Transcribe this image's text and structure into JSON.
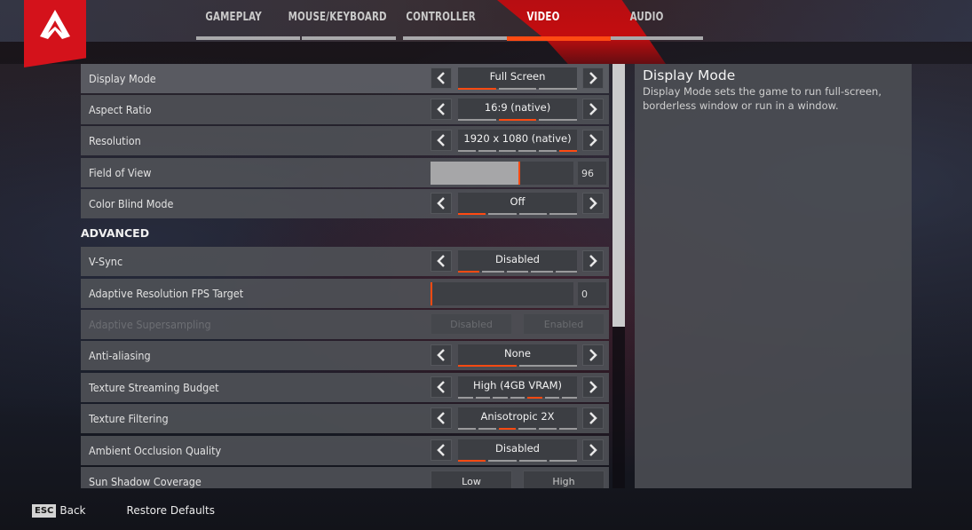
{
  "nav": {
    "logo": "apex-legends-logo",
    "tabs": [
      {
        "label": "GAMEPLAY",
        "active": false
      },
      {
        "label": "MOUSE/KEYBOARD",
        "active": false
      },
      {
        "label": "CONTROLLER",
        "active": false
      },
      {
        "label": "VIDEO",
        "active": true
      },
      {
        "label": "AUDIO",
        "active": false
      }
    ]
  },
  "colors": {
    "accent": "#ff4a12",
    "brand_red": "#d4121b",
    "row_bg": "#4e5056",
    "control_bg": "#3c3e43"
  },
  "settings": {
    "basic": [
      {
        "label": "Display Mode",
        "type": "selector",
        "value": "Full Screen",
        "options_count": 3,
        "selected_index": 0,
        "selected": true
      },
      {
        "label": "Aspect Ratio",
        "type": "selector",
        "value": "16:9 (native)",
        "options_count": 3,
        "selected_index": 1
      },
      {
        "label": "Resolution",
        "type": "selector",
        "value": "1920 x 1080 (native)",
        "options_count": 6,
        "selected_index": 5
      },
      {
        "label": "Field of View",
        "type": "slider",
        "value": "96",
        "fill_fraction": 0.62
      },
      {
        "label": "Color Blind Mode",
        "type": "selector",
        "value": "Off",
        "options_count": 4,
        "selected_index": 0
      }
    ],
    "advanced_header": "ADVANCED",
    "advanced": [
      {
        "label": "V-Sync",
        "type": "selector",
        "value": "Disabled",
        "options_count": 5,
        "selected_index": 0
      },
      {
        "label": "Adaptive Resolution FPS Target",
        "type": "slider",
        "value": "0",
        "fill_fraction": 0.0
      },
      {
        "label": "Adaptive Supersampling",
        "type": "toggle",
        "disabled": true,
        "options": [
          "Disabled",
          "Enabled"
        ]
      },
      {
        "label": "Anti-aliasing",
        "type": "selector",
        "value": "None",
        "options_count": 2,
        "selected_index": 0
      },
      {
        "label": "Texture Streaming Budget",
        "type": "selector",
        "value": "High (4GB VRAM)",
        "options_count": 7,
        "selected_index": 4
      },
      {
        "label": "Texture Filtering",
        "type": "selector",
        "value": "Anisotropic 2X",
        "options_count": 6,
        "selected_index": 2
      },
      {
        "label": "Ambient Occlusion Quality",
        "type": "selector",
        "value": "Disabled",
        "options_count": 4,
        "selected_index": 0
      },
      {
        "label": "Sun Shadow Coverage",
        "type": "toggle",
        "disabled": false,
        "options": [
          "Low",
          "High"
        ]
      }
    ]
  },
  "description": {
    "title": "Display Mode",
    "body": "Display Mode sets the game to run full-screen, borderless window or run in a window."
  },
  "scrollbar": {
    "visible_fraction": 0.62,
    "position": 0.0
  },
  "footer": {
    "esc_key": "ESC",
    "back_label": "Back",
    "restore_label": "Restore Defaults"
  }
}
